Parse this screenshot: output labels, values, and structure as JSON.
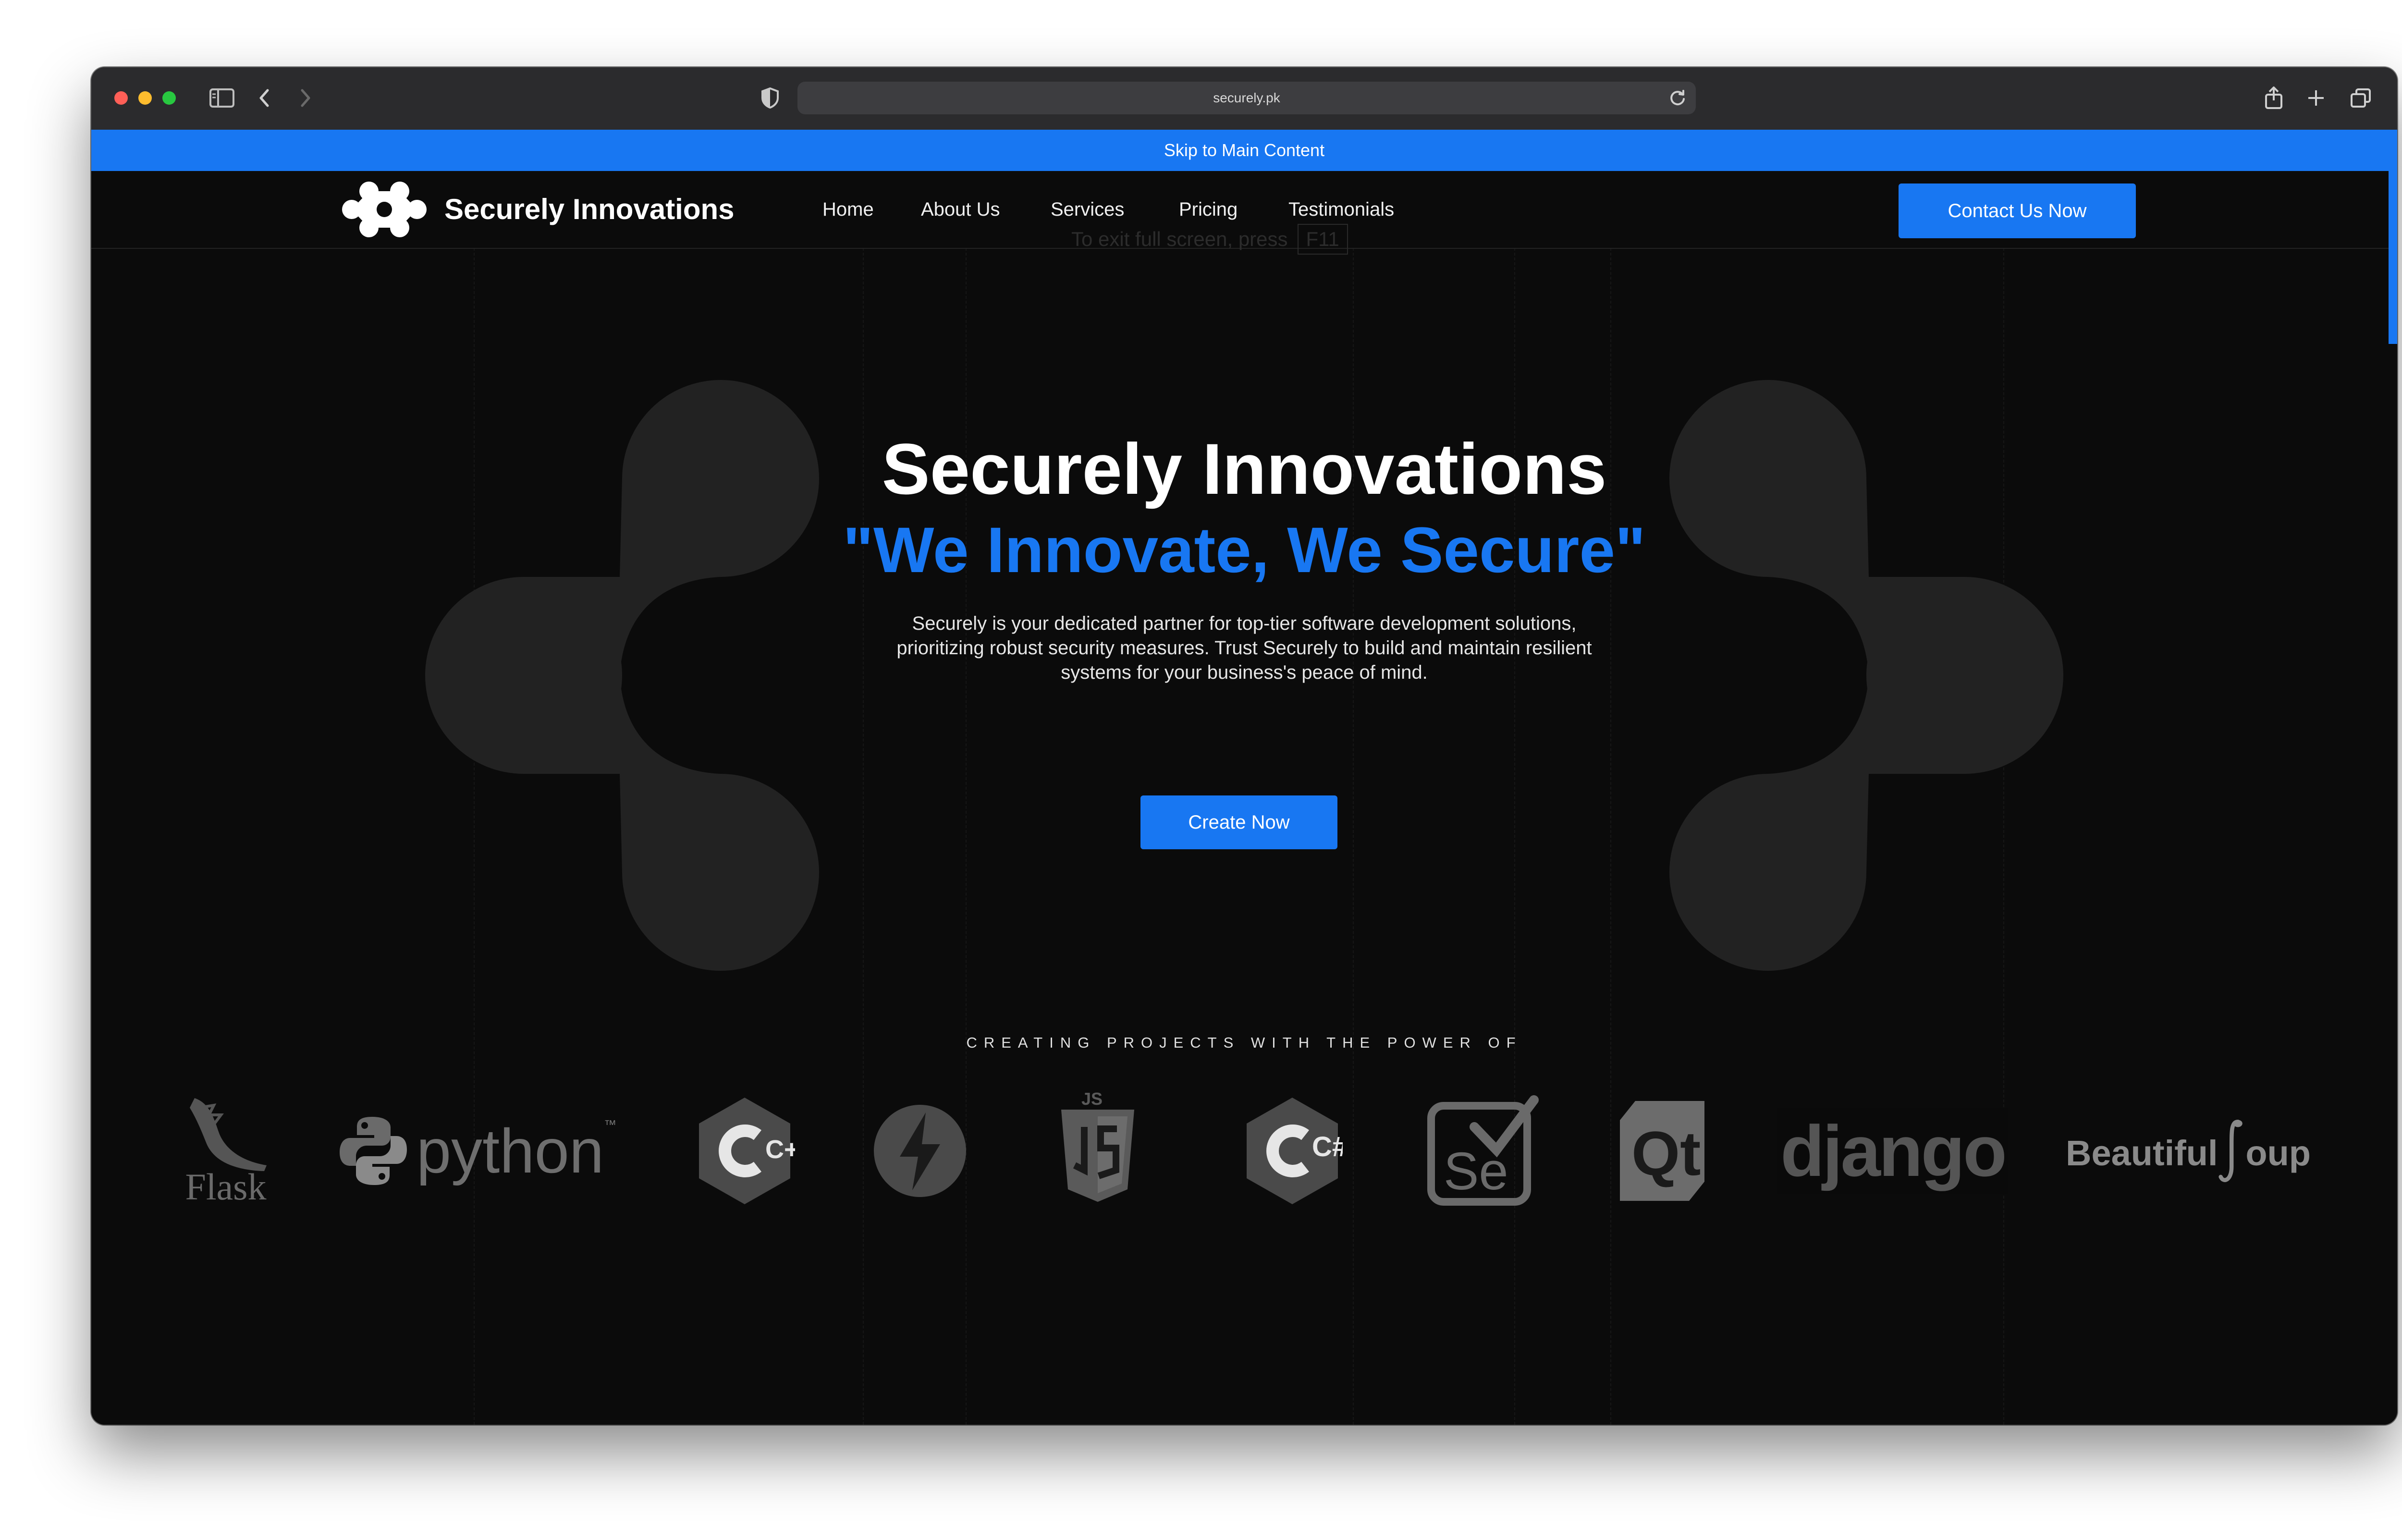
{
  "browser": {
    "url": "securely.pk"
  },
  "skip_link": "Skip to Main Content",
  "header": {
    "brand": "Securely Innovations",
    "nav": [
      "Home",
      "About Us",
      "Services",
      "Pricing",
      "Testimonials"
    ],
    "cta": "Contact Us Now"
  },
  "fullscreen_hint": {
    "text": "To exit full screen, press",
    "key": "F11"
  },
  "hero": {
    "title": "Securely Innovations",
    "slogan": "\"We Innovate, We Secure\"",
    "description_lines": [
      "Securely is your dedicated partner for top-tier software development solutions,",
      "prioritizing robust security measures. Trust Securely to build and maintain resilient",
      "systems for your business's peace of mind."
    ],
    "button": "Create Now"
  },
  "tech_stack": {
    "heading": "CREATING PROJECTS WITH THE POWER OF",
    "items": [
      {
        "name": "flask-logo",
        "label": "Flask"
      },
      {
        "name": "python-logo",
        "label": "python",
        "mark": "™"
      },
      {
        "name": "cpp-logo",
        "label": "C++"
      },
      {
        "name": "fastapi-logo",
        "label": ""
      },
      {
        "name": "javascript-logo",
        "label": "JS"
      },
      {
        "name": "csharp-logo",
        "label": "C#"
      },
      {
        "name": "selenium-logo",
        "label": "Se"
      },
      {
        "name": "qt-logo",
        "label": "Qt"
      },
      {
        "name": "django-logo",
        "label": "django"
      },
      {
        "name": "beautifulsoup-logo",
        "label": "Beautiful",
        "label2": "oup"
      }
    ]
  },
  "colors": {
    "accent": "#1877f2",
    "background": "#0b0b0b",
    "logo_gray": "#777777"
  }
}
